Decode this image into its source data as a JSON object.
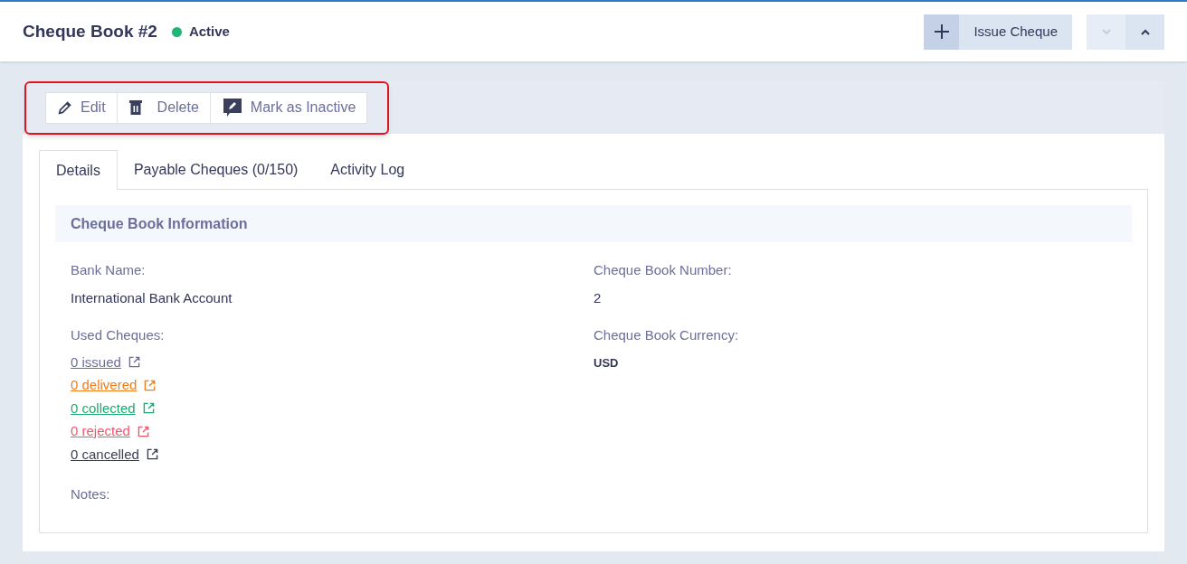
{
  "header": {
    "title": "Cheque Book #2",
    "status": {
      "label": "Active",
      "color": "#1fb573"
    },
    "issue_button": "Issue Cheque",
    "nav": [
      {
        "kind": "down",
        "disabled": true
      },
      {
        "kind": "up",
        "disabled": false
      }
    ]
  },
  "action_bar": {
    "highlighted": true,
    "buttons": [
      {
        "kind": "edit",
        "label": "Edit"
      },
      {
        "kind": "delete",
        "label": "Delete"
      },
      {
        "kind": "inactive",
        "label": "Mark as Inactive"
      }
    ]
  },
  "tabs": [
    {
      "label": "Details",
      "selected": true
    },
    {
      "label": "Payable Cheques (0/150)",
      "selected": false
    },
    {
      "label": "Activity Log",
      "selected": false
    }
  ],
  "section_title": "Cheque Book Information",
  "fields_left": [
    {
      "label": "Bank Name:",
      "value": "International Bank Account"
    }
  ],
  "fields_right": [
    {
      "label": "Cheque Book Number:",
      "value": "2"
    },
    {
      "label": "Cheque Book Currency:",
      "value": "USD"
    }
  ],
  "used_cheques": {
    "label": "Used Cheques:",
    "links": [
      {
        "label": "0 issued",
        "color": "#6b6f9a"
      },
      {
        "label": "0 delivered",
        "color": "#f07c1e"
      },
      {
        "label": "0 collected",
        "color": "#1fa971"
      },
      {
        "label": "0 rejected",
        "color": "#f0566e"
      },
      {
        "label": "0 cancelled",
        "color": "#3a3f55"
      }
    ]
  },
  "notes_label": "Notes:"
}
